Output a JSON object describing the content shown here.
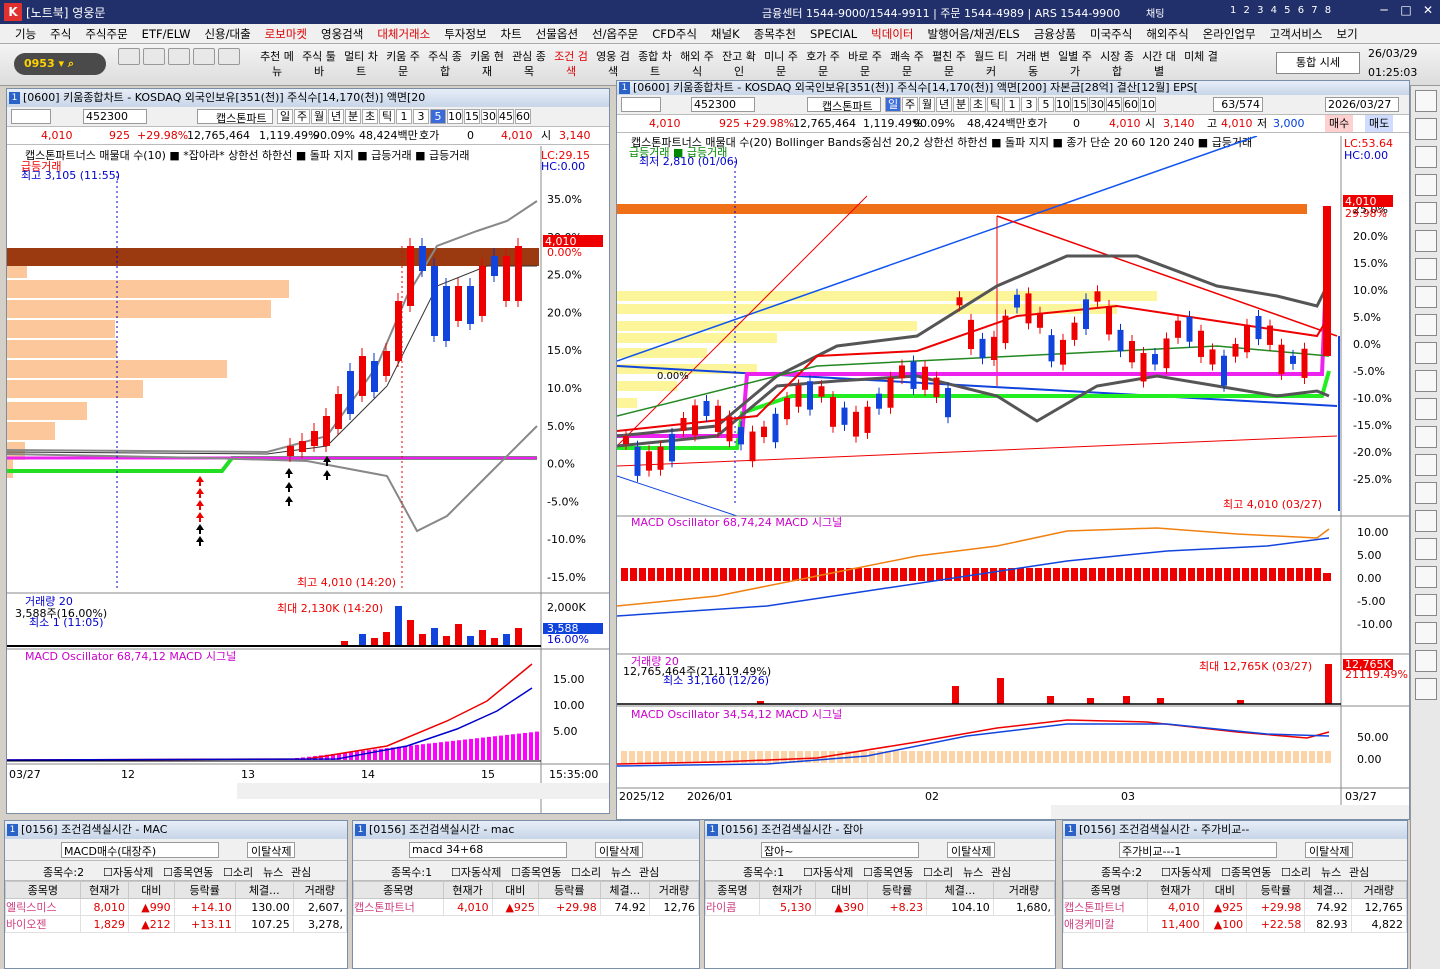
{
  "app": {
    "title": "[노트북] 영웅문",
    "center": "금융센터 1544-9000/1544-9911 | 주문 1544-4989 | ARS 1544-9900",
    "chat": "채팅",
    "pages": "1 2 3 4 5 6 7 8"
  },
  "menu": [
    "기능",
    "주식",
    "주식주문",
    "ETF/ELW",
    "신용/대출",
    "로보마켓",
    "영웅검색",
    "대체거래소",
    "투자정보",
    "차트",
    "선물옵션",
    "선/옵주문",
    "CFD주식",
    "채널K",
    "종목추천",
    "SPECIAL",
    "빅데이터",
    "발행어음/채권/ELS",
    "금융상품",
    "미국주식",
    "해외주식",
    "온라인업무",
    "고객서비스",
    "보기"
  ],
  "menu_red": [
    "로보마켓",
    "대체거래소",
    "빅데이터"
  ],
  "toolbar": {
    "account": "0953",
    "buttons": [
      "추천 메뉴",
      "주식 툴바",
      "멀티 차트",
      "키움 주문",
      "주식 종합",
      "키움 현재",
      "관심 종목",
      "조건 검색",
      "영웅 검색",
      "종합 차트",
      "해외 주식",
      "잔고 확인",
      "미니 주문",
      "호가 주문",
      "바로 주문",
      "쾌속 주문",
      "펼친 주문",
      "월드 티커",
      "거래 변동",
      "일별 주가",
      "시장 종합",
      "시간 대별",
      "미체 결"
    ],
    "integrated": "통합 시세",
    "date": "26/03/29",
    "time": "01:25:03"
  },
  "left_chart": {
    "title": "[0600] 키움종합차트 - KOSDAQ 외국인보유[351(천)] 주식수[14,170(천)] 액면[20",
    "code": "452300",
    "name": "캡스톤파트",
    "periods": [
      "일",
      "주",
      "월",
      "년",
      "분",
      "초",
      "틱",
      "1",
      "3",
      "5",
      "10",
      "15",
      "30",
      "45",
      "60"
    ],
    "sel_period": "5",
    "price": "4,010",
    "change": "925",
    "rate": "+29.98%",
    "volume": "12,765,464",
    "vol_rate": "1,119.49%",
    "ratio": "90.09%",
    "amount": "48,424백만",
    "hoga": "호가",
    "zero": "0",
    "hi": "4,010",
    "lo_lbl": "시",
    "open": "3,140",
    "legend": "캡스톤파트너스 매물대 수(10) ■ *잡아라* 상한선 하한선 ■ 돌파 지지 ■ 급등거래 ■ 급등거래",
    "sub_legend": "급등거래",
    "max_label": "최고 3,105 (11:55)",
    "lc": "LC:29.15",
    "hc": "HC:0.00",
    "high_note": "최고 4,010 (14:20)",
    "price_tag": "4,010",
    "price_tag2": "0.00%",
    "y_labels": [
      "35.0%",
      "30.0%",
      "25.0%",
      "20.0%",
      "15.0%",
      "10.0%",
      "5.0%",
      "0.0%",
      "-5.0%",
      "-10.0%",
      "-15.0%"
    ],
    "vol_legend": "거래량 20",
    "vol_info": "3,588주(16.00%)",
    "vol_min": "최소 1 (11:05)",
    "vol_max": "최대 2,130K (14:20)",
    "vol_axis": "2,000K",
    "vol_tag": "3,588",
    "vol_tag2": "16.00%",
    "macd_legend": "MACD Oscillator 68,74,12  MACD  시그널",
    "macd_axis": [
      "15.00",
      "10.00",
      "5.00"
    ],
    "x_labels": [
      "03/27",
      "12",
      "13",
      "14",
      "15",
      "15:35:00"
    ]
  },
  "right_chart": {
    "title": "[0600] 키움종합차트 - KOSDAQ 외국인보유[351(천)] 주식수[14,170(천)] 액면[200] 자본금[28억] 결산[12월] EPS[",
    "code": "452300",
    "name": "캡스톤파트",
    "periods": [
      "일",
      "주",
      "월",
      "년",
      "분",
      "초",
      "틱",
      "1",
      "3",
      "5",
      "10",
      "15",
      "30",
      "45",
      "60",
      "10"
    ],
    "count": "63",
    "total": "/574",
    "date": "2026/03/27",
    "price": "4,010",
    "change": "925",
    "rate": "+29.98%",
    "volume": "12,765,464",
    "vol_rate": "1,119.49%",
    "ratio": "90.09%",
    "amount": "48,424백만",
    "hoga": "호가",
    "zero": "0",
    "p1": "4,010",
    "lbl1": "시",
    "p2": "3,140",
    "lbl2": "고",
    "p3": "4,010",
    "lbl3": "저",
    "p4": "3,000",
    "buy": "매수",
    "sell": "매도",
    "legend": "캡스톤파트너스 매물대 수(20) Bollinger Bands중심선 20,2 상한선 하한선 ■ 돌파 지지 ■ 종가 단순 20 60 120 240 ■ 급등거래",
    "sub": "급등거래 ■ 급등거래",
    "min_label": "최저 2,810 (01/06)",
    "lc": "LC:53.64",
    "hc": "HC:0.00",
    "ref": "0.00%",
    "high_note": "최고 4,010 (03/27)",
    "price_tag": "4,010",
    "price_tag2": "29.98%",
    "y_labels": [
      "25.0%",
      "20.0%",
      "15.0%",
      "10.0%",
      "5.0%",
      "0.0%",
      "-5.0%",
      "-10.0%",
      "-15.0%",
      "-20.0%",
      "-25.0%"
    ],
    "macd1_legend": "MACD Oscillator 68,74,24  MACD  시그널",
    "macd1_axis": [
      "10.00",
      "5.00",
      "0.00",
      "-5.00",
      "-10.00"
    ],
    "vol_legend": "거래량 20",
    "vol_info": "12,765,464주(21,119.49%)",
    "vol_min": "최소 31,160 (12/26)",
    "vol_max": "최대 12,765K (03/27)",
    "vol_tag": "12,765K",
    "vol_tag2": "21119.49%",
    "macd2_legend": "MACD Oscillator 34,54,12  MACD  시그널",
    "macd2_axis": [
      "50.00",
      "0.00"
    ],
    "x_labels": [
      "2025/12",
      "2026/01",
      "02",
      "03",
      "03/27"
    ]
  },
  "panels": [
    {
      "title": "[0156] 조건검색실시간 - MAC",
      "cond": "MACD매수(대장주)",
      "count": "종목수:2",
      "rows": [
        {
          "name": "엘릭스미스",
          "price": "8,010",
          "diff": "990",
          "rate": "+14.10",
          "exec": "130.00",
          "vol": "2,607,"
        },
        {
          "name": "바이오젠",
          "price": "1,829",
          "diff": "212",
          "rate": "+13.11",
          "exec": "107.25",
          "vol": "3,278,"
        }
      ]
    },
    {
      "title": "[0156] 조건검색실시간 - mac",
      "cond": "macd 34+68",
      "count": "종목수:1",
      "rows": [
        {
          "name": "캡스톤파트너",
          "price": "4,010",
          "diff": "925",
          "rate": "+29.98",
          "exec": "74.92",
          "vol": "12,76"
        }
      ]
    },
    {
      "title": "[0156] 조건검색실시간 - 잡아",
      "cond": "잡아~",
      "count": "종목수:1",
      "rows": [
        {
          "name": "라이콤",
          "price": "5,130",
          "diff": "390",
          "rate": "+8.23",
          "exec": "104.10",
          "vol": "1,680,"
        }
      ]
    },
    {
      "title": "[0156] 조건검색실시간 - 주가비교--",
      "cond": "주가비교---1",
      "count": "종목수:2",
      "rows": [
        {
          "name": "캡스톤파트너",
          "price": "4,010",
          "diff": "925",
          "rate": "+29.98",
          "exec": "74.92",
          "vol": "12,765"
        },
        {
          "name": "애경케미칼",
          "price": "11,400",
          "diff": "100",
          "rate": "+22.58",
          "exec": "82.93",
          "vol": "4,822"
        }
      ]
    }
  ],
  "panel_labels": {
    "btn_del": "이탈삭제",
    "auto": "자동삭제",
    "link": "종목연동",
    "sound": "소리",
    "news": "뉴스",
    "fav": "관심",
    "cols": [
      "종목명",
      "현재가",
      "대비",
      "등락률",
      "체결...",
      "거래량"
    ]
  }
}
